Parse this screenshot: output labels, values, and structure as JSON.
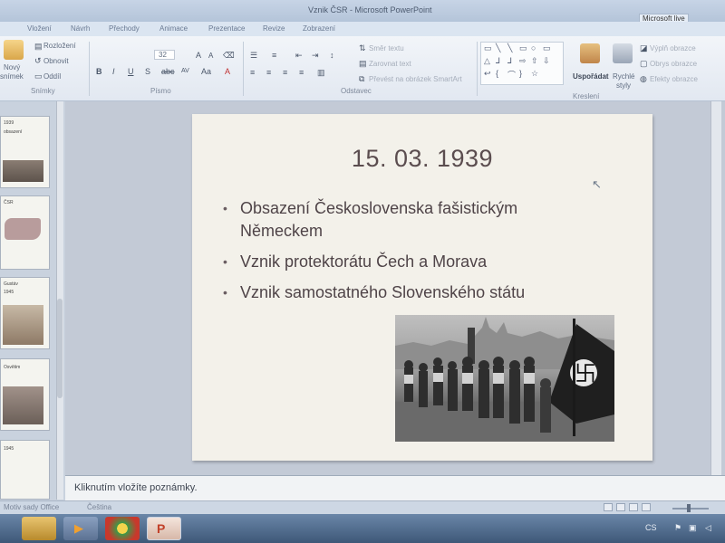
{
  "window": {
    "title": "Vznik ČSR - Microsoft PowerPoint",
    "account_label": "Microsoft live"
  },
  "ribbon_tabs": [
    {
      "label": "Vložení"
    },
    {
      "label": "Návrh"
    },
    {
      "label": "Přechody"
    },
    {
      "label": "Animace"
    },
    {
      "label": "Prezentace"
    },
    {
      "label": "Revize"
    },
    {
      "label": "Zobrazení"
    }
  ],
  "ribbon": {
    "slides_group": {
      "new_slide_label_1": "Nový",
      "new_slide_label_2": "snímek",
      "layout_label": "Rozložení",
      "reset_label": "Obnovit",
      "section_label": "Oddíl",
      "group_label": "Snímky"
    },
    "font_group": {
      "size_value": "32",
      "group_label": "Písmo"
    },
    "paragraph_group": {
      "text_direction_label": "Směr textu",
      "align_text_label": "Zarovnat text",
      "convert_smartart_label": "Převést na obrázek SmartArt",
      "group_label": "Odstavec"
    },
    "drawing_group": {
      "arrange_label": "Uspořádat",
      "quick_styles_label_1": "Rychlé",
      "quick_styles_label_2": "styly",
      "shape_fill_label": "Výplň obrazce",
      "shape_outline_label": "Obrys obrazce",
      "shape_effects_label": "Efekty obrazce",
      "group_label": "Kreslení"
    }
  },
  "slide_pane": {
    "thumbnails": [
      {
        "line1": "1939",
        "line2": "obsazení"
      },
      {
        "line1": "ČSR"
      },
      {
        "line1": "Gustáv",
        "line2": "1945"
      },
      {
        "line1": "Osvětim"
      },
      {
        "line1": "1945"
      }
    ]
  },
  "slide": {
    "title": "15. 03. 1939",
    "bullets": [
      {
        "line1": "Obsazení Československa fašistickým",
        "line2": "Německem"
      },
      {
        "line1": "Vznik protektorátu Čech a Morava"
      },
      {
        "line1": "Vznik samostatného Slovenského státu"
      }
    ]
  },
  "notes": {
    "placeholder": "Kliknutím vložíte poznámky."
  },
  "status_bar": {
    "theme_label": "Motiv sady Office",
    "language_label": "Čeština"
  },
  "taskbar": {
    "tray_text": "CS"
  },
  "colors": {
    "slide_background": "#f3f1ea",
    "slide_text": "#4f4448",
    "ribbon_background": "#e6ecf3",
    "taskbar": "#4a6485"
  }
}
